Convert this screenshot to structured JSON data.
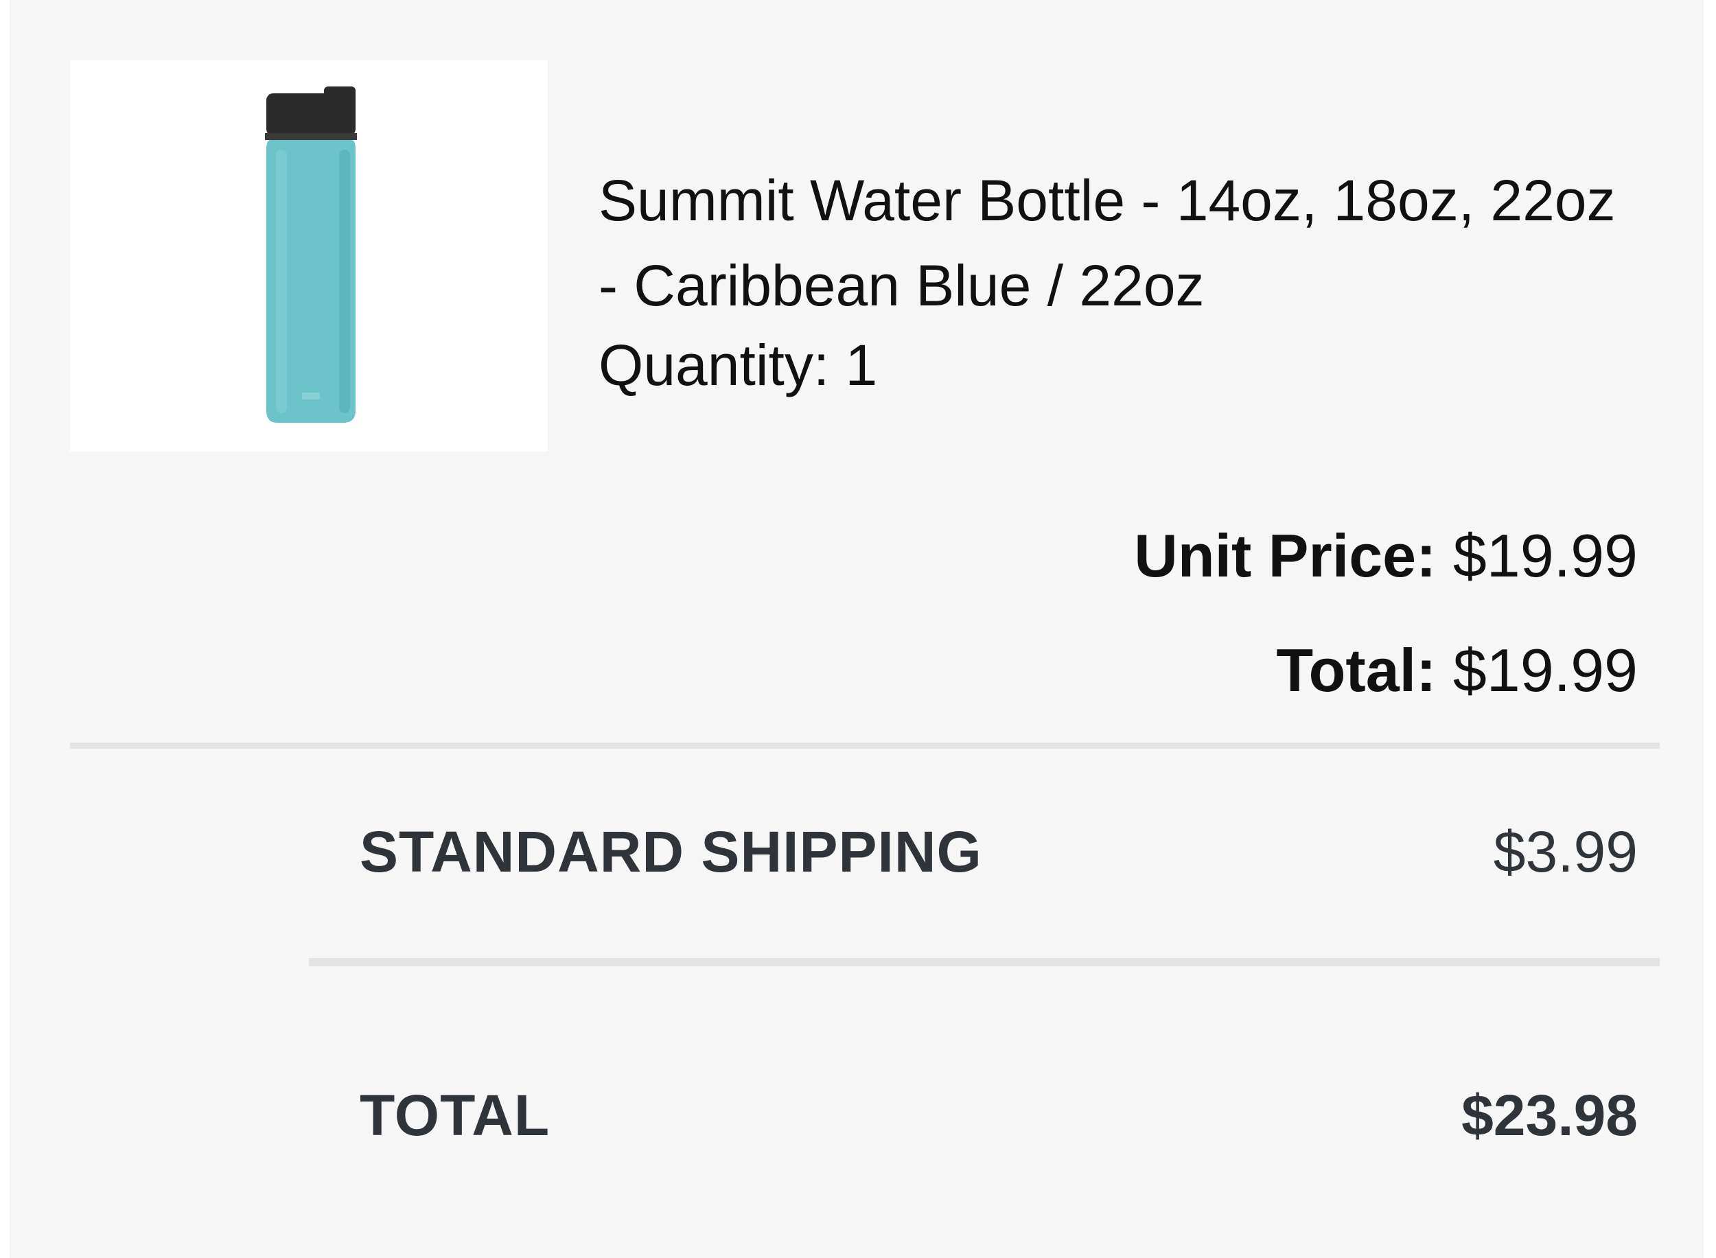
{
  "product": {
    "title": "Summit Water Bottle - 14oz, 18oz, 22oz - Caribbean Blue / 22oz",
    "quantity_text": "Quantity: 1",
    "image_icon": "water-bottle-icon",
    "bottle_color": "#6cc3c9",
    "cap_color": "#2b2b2b"
  },
  "pricing": {
    "unit_price_label": "Unit Price:",
    "unit_price_value": "$19.99",
    "line_total_label": "Total:",
    "line_total_value": "$19.99"
  },
  "summary": {
    "shipping_label": "STANDARD SHIPPING",
    "shipping_value": "$3.99",
    "total_label": "TOTAL",
    "total_value": "$23.98"
  }
}
